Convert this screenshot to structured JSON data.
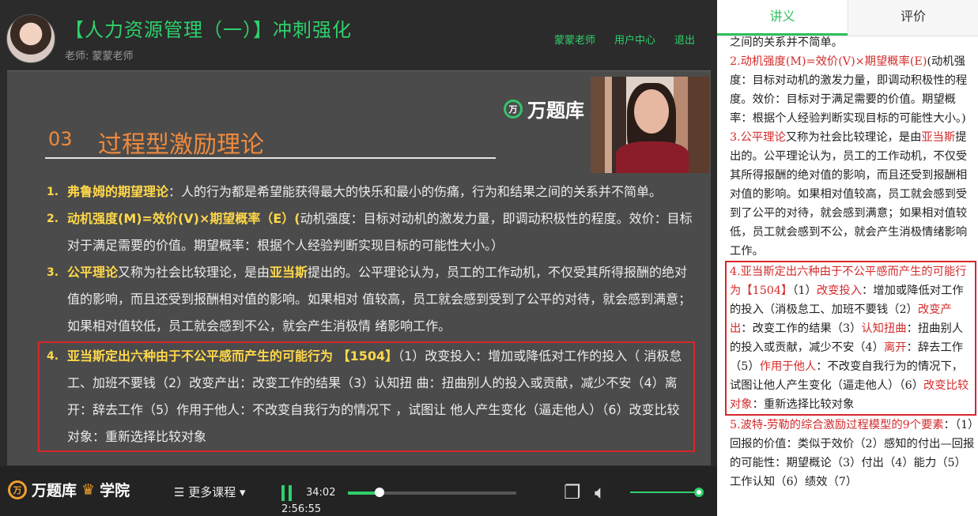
{
  "header": {
    "title": "【人力资源管理（一）】冲刺强化",
    "teacher_line": "老师: 蒙蒙老师",
    "nav": [
      "蒙蒙老师",
      "用户中心",
      "退出"
    ]
  },
  "slide": {
    "watermark": "万题库",
    "watermark_badge": "万",
    "section_number": "03",
    "section_title": "过程型激励理论",
    "items": [
      {
        "num": "1.",
        "em": "弗鲁姆的期望理论",
        "text": "：人的行为都是希望能获得最大的快乐和最小的伤痛，行为和结果之间的关系并不简单。"
      },
      {
        "num": "2.",
        "em": "动机强度(M)=效价(V)×期望概率（E）(",
        "text": "动机强度：目标对动机的激发力量，即调动积极性的程度。效价：目标对于满足需要的价值。期望概率：根据个人经验判断实现目标的可能性大小。）"
      },
      {
        "num": "3.",
        "em": "公平理论",
        "text": "又称为社会比较理论，是由",
        "em2": "亚当斯",
        "text2": "提出的。公平理论认为，员工的工作动机，不仅受其所得报酬的绝对值的影响，而且还受到报酬相对值的影响。如果相对 值较高，员工就会感到受到了公平的对待，就会感到满意；如果相对值较低，员工就会感到不公，就会产生消极情 绪影响工作。"
      },
      {
        "num": "4.",
        "em": "亚当斯定出六种由于不公平感而产生的可能行为 【1504】",
        "text": "（1）改变投入：增加或降低对工作的投入（ 消极怠工、加班不要钱（2）改变产出：改变工作的结果（3）认知扭 曲：扭曲别人的投入或贡献，减少不安（4）离开：辞去工作（5）作用于他人：不改变自我行为的情况下 ，试图让 他人产生变化（逼走他人）（6）改变比较对象：重新选择比较对象"
      }
    ]
  },
  "controls": {
    "brand_badge": "万",
    "brand_name": "万题库",
    "brand_academy": "学院",
    "more_courses": "☰ 更多课程 ▾",
    "current_time": "34:02",
    "total_time": "2:56:55",
    "progress_fraction": 0.19,
    "volume_fraction": 1.0
  },
  "side_panel": {
    "tabs": [
      "讲义",
      "评价"
    ],
    "active_tab": "讲义",
    "notes": {
      "p0": "之间的关系并不简单。",
      "p1_red": "2.动机强度(M)=效价(V)×期望概率(E)",
      "p1_rest": "(动机强度：目标对动机的激发力量，即调动积极性的程度。效价：目标对于满足需要的价值。期望概率：根据个人经验判断实现目标的可能性大小。)",
      "p2_red": "3.公平理论",
      "p2_a": "又称为社会比较理论，是由",
      "p2_red2": "亚当斯",
      "p2_b": "提出的。公平理论认为，员工的工作动机，不仅受其所得报酬的绝对值的影响，而且还受到报酬相对值的影响。如果相对值较高，员工就会感到受到了公平的对待，就会感到满意；如果相对值较低，员工就会感到不公，就会产生消极情绪影响工作。",
      "p3_red": "4.亚当斯定出六种由于不公平感而产生的可能行为【1504】",
      "p3_a": "（1）",
      "p3_r1": "改变投入",
      "p3_b": "：增加或降低对工作的投入（消极怠工、加班不要钱（2）",
      "p3_r2": "改变产出",
      "p3_c": "：改变工作的结果（3）",
      "p3_r3": "认知扭曲",
      "p3_d": "：扭曲别人的投入或贡献，减少不安（4）",
      "p3_r4": "离开",
      "p3_e": "：辞去工作（5）",
      "p3_r5": "作用于他人",
      "p3_f": "：不改变自我行为的情况下，试图让他人产生变化（逼走他人）（6）",
      "p3_r6": "改变比较对象",
      "p3_g": "：重新选择比较对象",
      "p4_red": "5.波特-劳勒的综合激励过程模型的9个要素",
      "p4_rest": "：（1）回报的价值：类似于效价（2）感知的付出—回报的可能性：期望概论（3）付出（4）能力（5）工作认知（6）绩效（7）"
    }
  },
  "colors": {
    "accent_green": "#2fd06c",
    "slide_yellow": "#ffd84a",
    "section_orange": "#f08a3c",
    "highlight_red": "#d8262b"
  },
  "icons": [
    "avatar",
    "pause-icon",
    "copy-icon",
    "volume-icon"
  ]
}
